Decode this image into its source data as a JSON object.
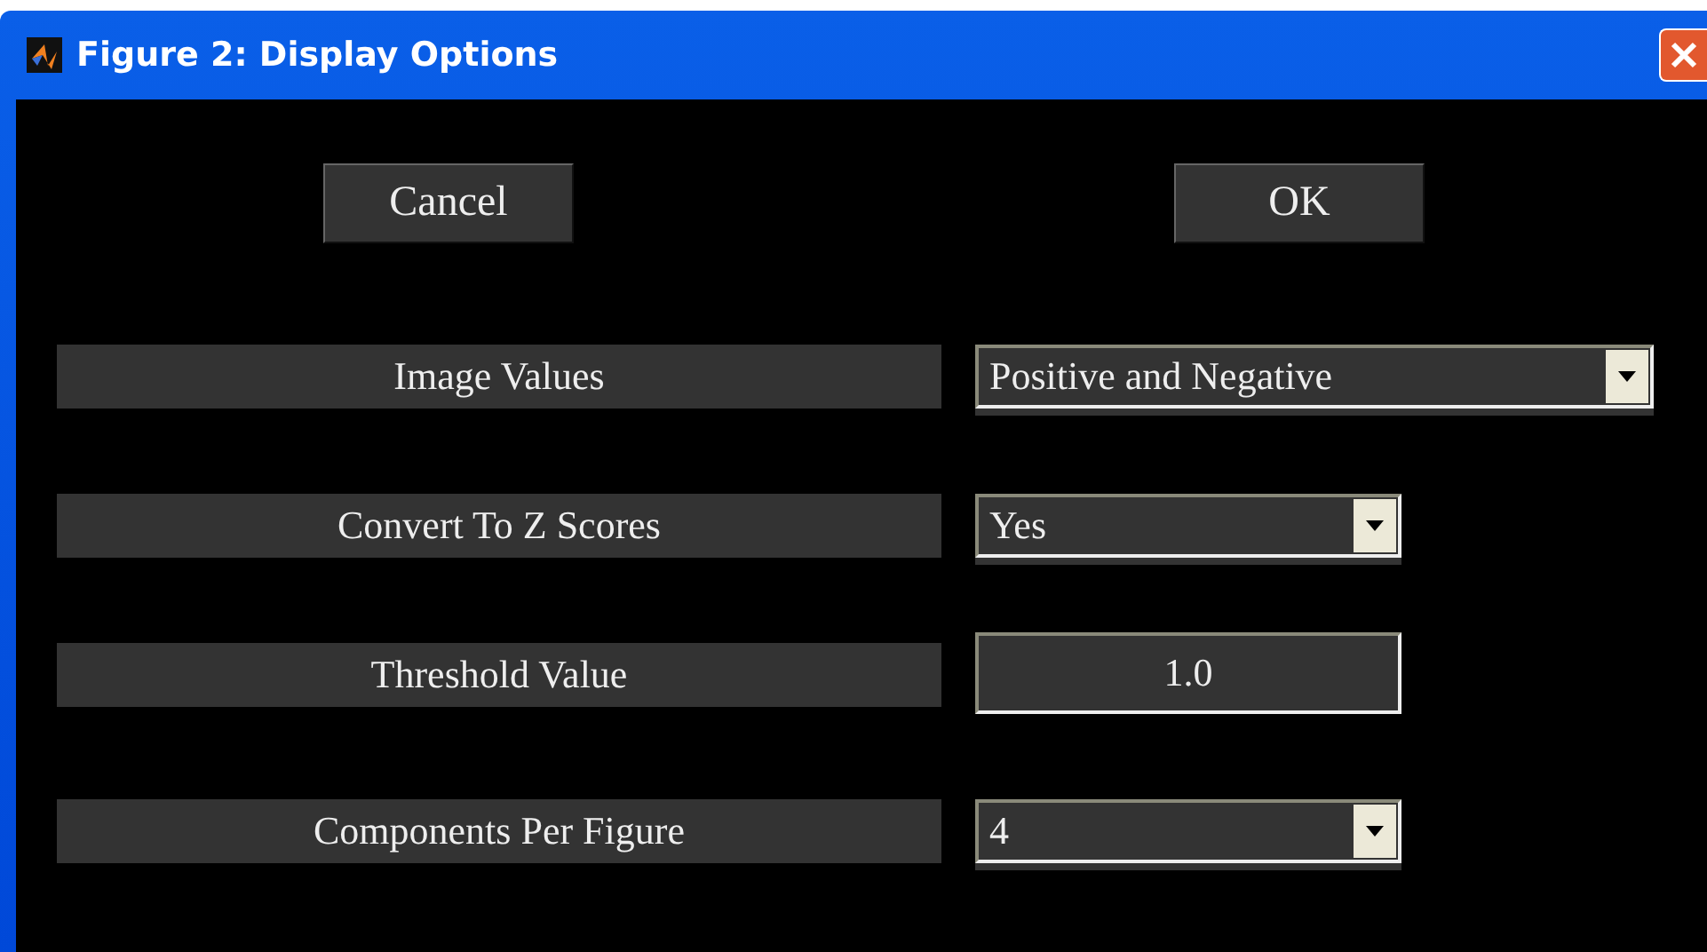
{
  "window": {
    "title": "Figure 2: Display Options"
  },
  "buttons": [
    {
      "label": "Cancel"
    },
    {
      "label": "OK"
    }
  ],
  "options": [
    {
      "label": "Image Values",
      "kind": "popup",
      "value": "Positive and Negative",
      "wide": true
    },
    {
      "label": "Convert To Z Scores",
      "kind": "popup",
      "value": "Yes",
      "wide": false
    },
    {
      "label": "Threshold Value",
      "kind": "edit",
      "value": "1.0",
      "wide": false
    },
    {
      "label": "Components Per Figure",
      "kind": "popup",
      "value": "4",
      "wide": false
    }
  ]
}
